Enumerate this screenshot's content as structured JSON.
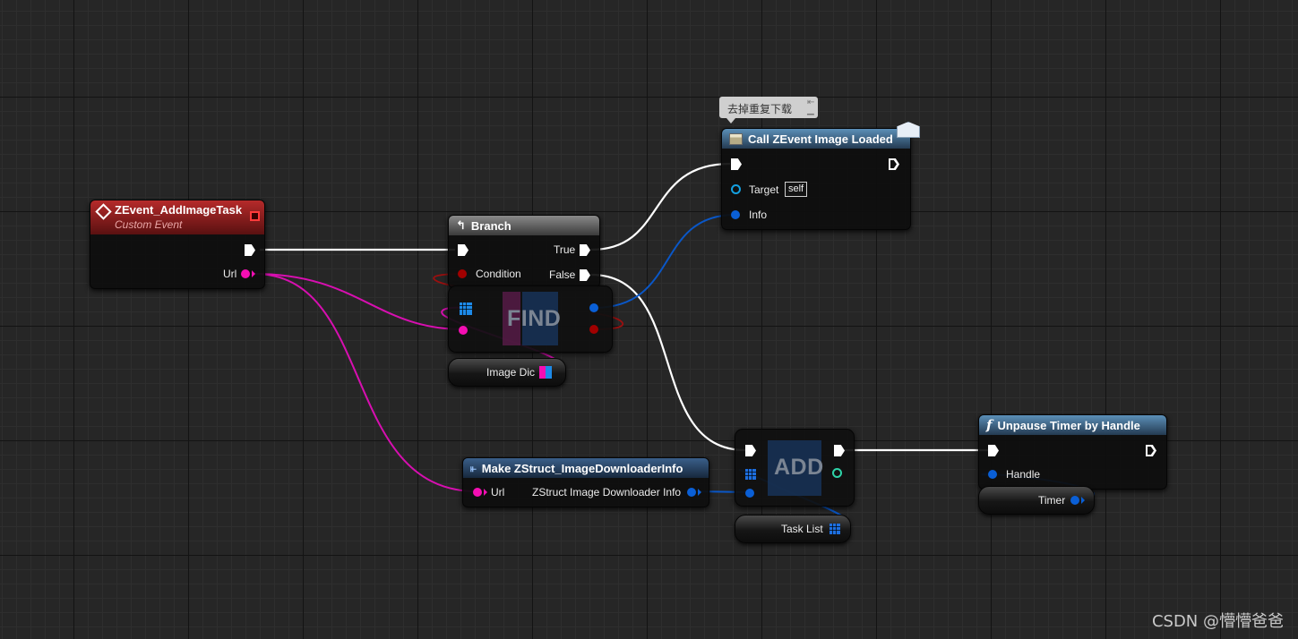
{
  "nodes": {
    "custom_event": {
      "title": "ZEvent_AddImageTask",
      "subtitle": "Custom Event",
      "url_label": "Url"
    },
    "branch": {
      "title": "Branch",
      "condition_label": "Condition",
      "true_label": "True",
      "false_label": "False"
    },
    "find": {
      "title": "FIND"
    },
    "image_dic": {
      "label": "Image Dic"
    },
    "call_event": {
      "comment": "去掉重复下载",
      "title": "Call ZEvent Image Loaded",
      "target_label": "Target",
      "target_default": "self",
      "info_label": "Info"
    },
    "make_struct": {
      "title": "Make ZStruct_ImageDownloaderInfo",
      "url_label": "Url",
      "output_label": "ZStruct Image Downloader Info"
    },
    "add": {
      "title": "ADD"
    },
    "task_list": {
      "label": "Task List"
    },
    "unpause": {
      "title": "Unpause Timer by Handle",
      "handle_label": "Handle"
    },
    "timer": {
      "label": "Timer"
    }
  },
  "watermark": "CSDN @懵懵爸爸",
  "colors": {
    "exec": "#ffffff",
    "string_pin": "#f50eb3",
    "struct_pin": "#0a5fd6",
    "bool_pin": "#a10000",
    "object_pin": "#14a0e0",
    "event_header": "#b52a2a",
    "function_header": "#5b8fb8"
  }
}
